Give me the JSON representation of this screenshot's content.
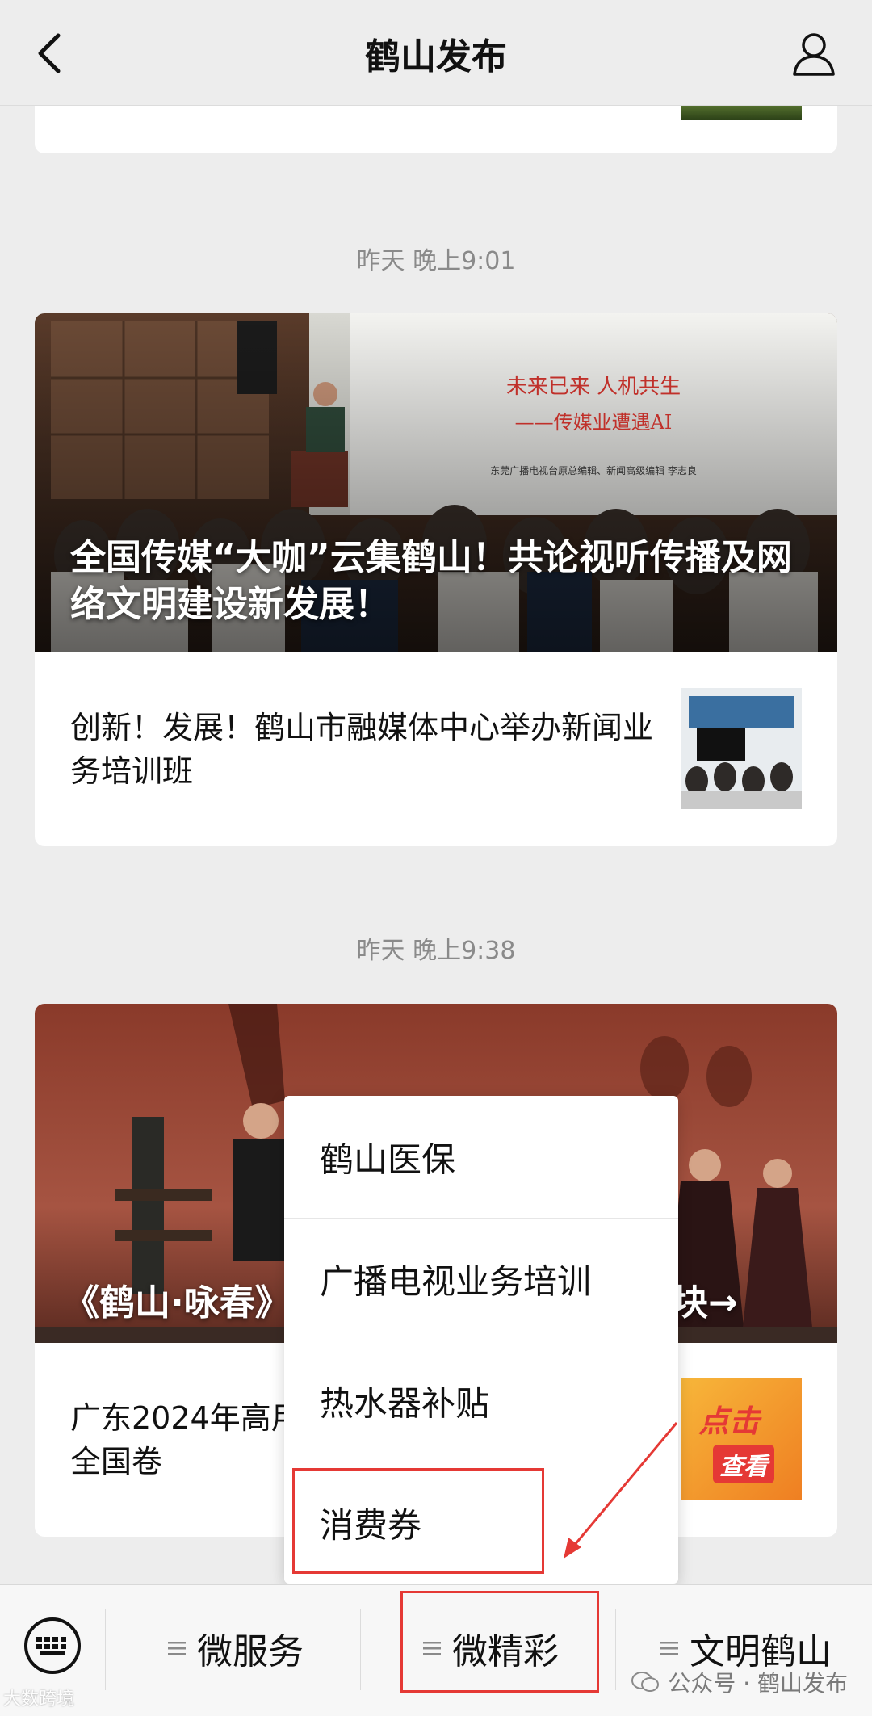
{
  "header": {
    "title": "鹤山发布"
  },
  "feed": [
    {
      "time": "昨天 晚上9:01",
      "hero_title": "全国传媒“大咖”云集鹤山！共论视听传播及网络文明建设新发展！",
      "slide_line1": "未来已来  人机共生",
      "slide_line2": "——传媒业遭遇AI",
      "slide_line3": "东莞广播电视台原总编辑、新闻高级编辑  李志良",
      "item_text": "创新！发展！鹤山市融媒体中心举办新闻业务培训班"
    },
    {
      "time": "昨天 晚上9:38",
      "hero_title_left": "《鹤山·咏春》",
      "hero_title_right": "块→",
      "item_text": "广东2024年高用全国卷",
      "thumb_text_1": "点击",
      "thumb_text_2": "查看"
    }
  ],
  "popup_menu": {
    "items": [
      "鹤山医保",
      "广播电视业务培训",
      "热水器补贴",
      "消费券"
    ]
  },
  "bottom_menu": {
    "tabs": [
      "微服务",
      "微精彩",
      "文明鹤山"
    ]
  },
  "watermark": {
    "text": "公众号 · 鹤山发布",
    "left": "大数跨境"
  },
  "colors": {
    "highlight": "#e53935",
    "background": "#ededed"
  }
}
